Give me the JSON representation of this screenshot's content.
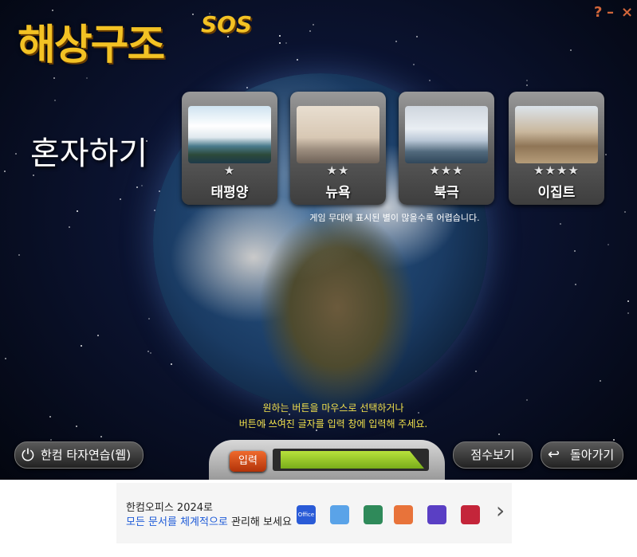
{
  "header": {
    "logo": "해상구조",
    "logo_suffix": "SOS",
    "help": "?",
    "minimize": "–",
    "close": "×"
  },
  "page_title": "혼자하기",
  "stages": [
    {
      "label": "태평양",
      "stars": "★",
      "difficulty": 1
    },
    {
      "label": "뉴욕",
      "stars": "★★",
      "difficulty": 2
    },
    {
      "label": "북극",
      "stars": "★★★",
      "difficulty": 3
    },
    {
      "label": "이집트",
      "stars": "★★★★",
      "difficulty": 4
    }
  ],
  "hint": "게임 무대에 표시된 별이 많을수록 어렵습니다.",
  "instructions": {
    "line1": "원하는 버튼을 마우스로 선택하거나",
    "line2": "버튼에 쓰여진 글자를 입력 창에 입력해 주세요."
  },
  "bottom": {
    "web_button": "한컴 타자연습(웹)",
    "input_label": "입력",
    "score_button": "점수보기",
    "back_button": "돌아가기"
  },
  "ad": {
    "title": "한컴오피스 2024로",
    "line2_highlight": "모든 문서를 체계적으로",
    "line2_rest": " 관리해 보세요",
    "office_label": "Office",
    "next": "›"
  }
}
